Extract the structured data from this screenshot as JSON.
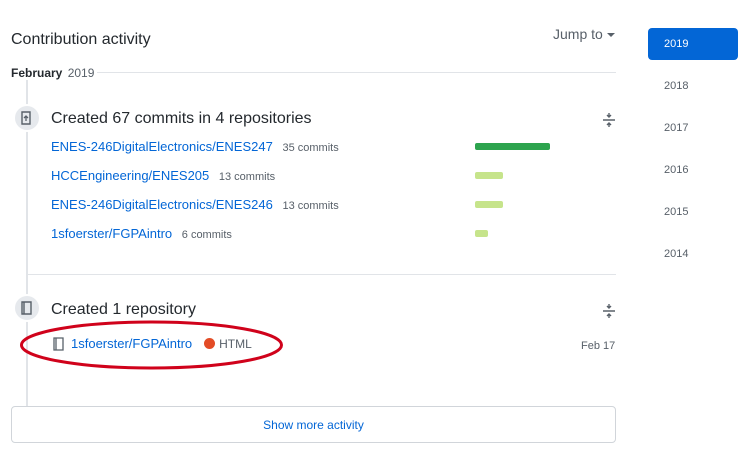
{
  "header": {
    "title": "Contribution activity",
    "jump_to": "Jump to"
  },
  "month": {
    "name": "February",
    "year": "2019"
  },
  "commits_section": {
    "title": "Created 67 commits in 4 repositories",
    "repos": [
      {
        "name": "ENES-246DigitalElectronics/ENES247",
        "count": "35 commits",
        "share": 1.0
      },
      {
        "name": "HCCEngineering/ENES205",
        "count": "13 commits",
        "share": 0.37
      },
      {
        "name": "ENES-246DigitalElectronics/ENES246",
        "count": "13 commits",
        "share": 0.37
      },
      {
        "name": "1sfoerster/FGPAintro",
        "count": "6 commits",
        "share": 0.17
      }
    ]
  },
  "repo_section": {
    "title": "Created 1 repository",
    "repo": {
      "name": "1sfoerster/FGPAintro",
      "language": "HTML",
      "language_color": "#e34c26",
      "date": "Feb 17"
    }
  },
  "show_more": "Show more activity",
  "years": [
    "2019",
    "2018",
    "2017",
    "2016",
    "2015",
    "2014"
  ],
  "active_year": "2019",
  "colors": {
    "accent": "#0366d6",
    "bar_strong": "#2da44e",
    "bar_light": "#c6e48b",
    "annotation": "#d0021b"
  }
}
